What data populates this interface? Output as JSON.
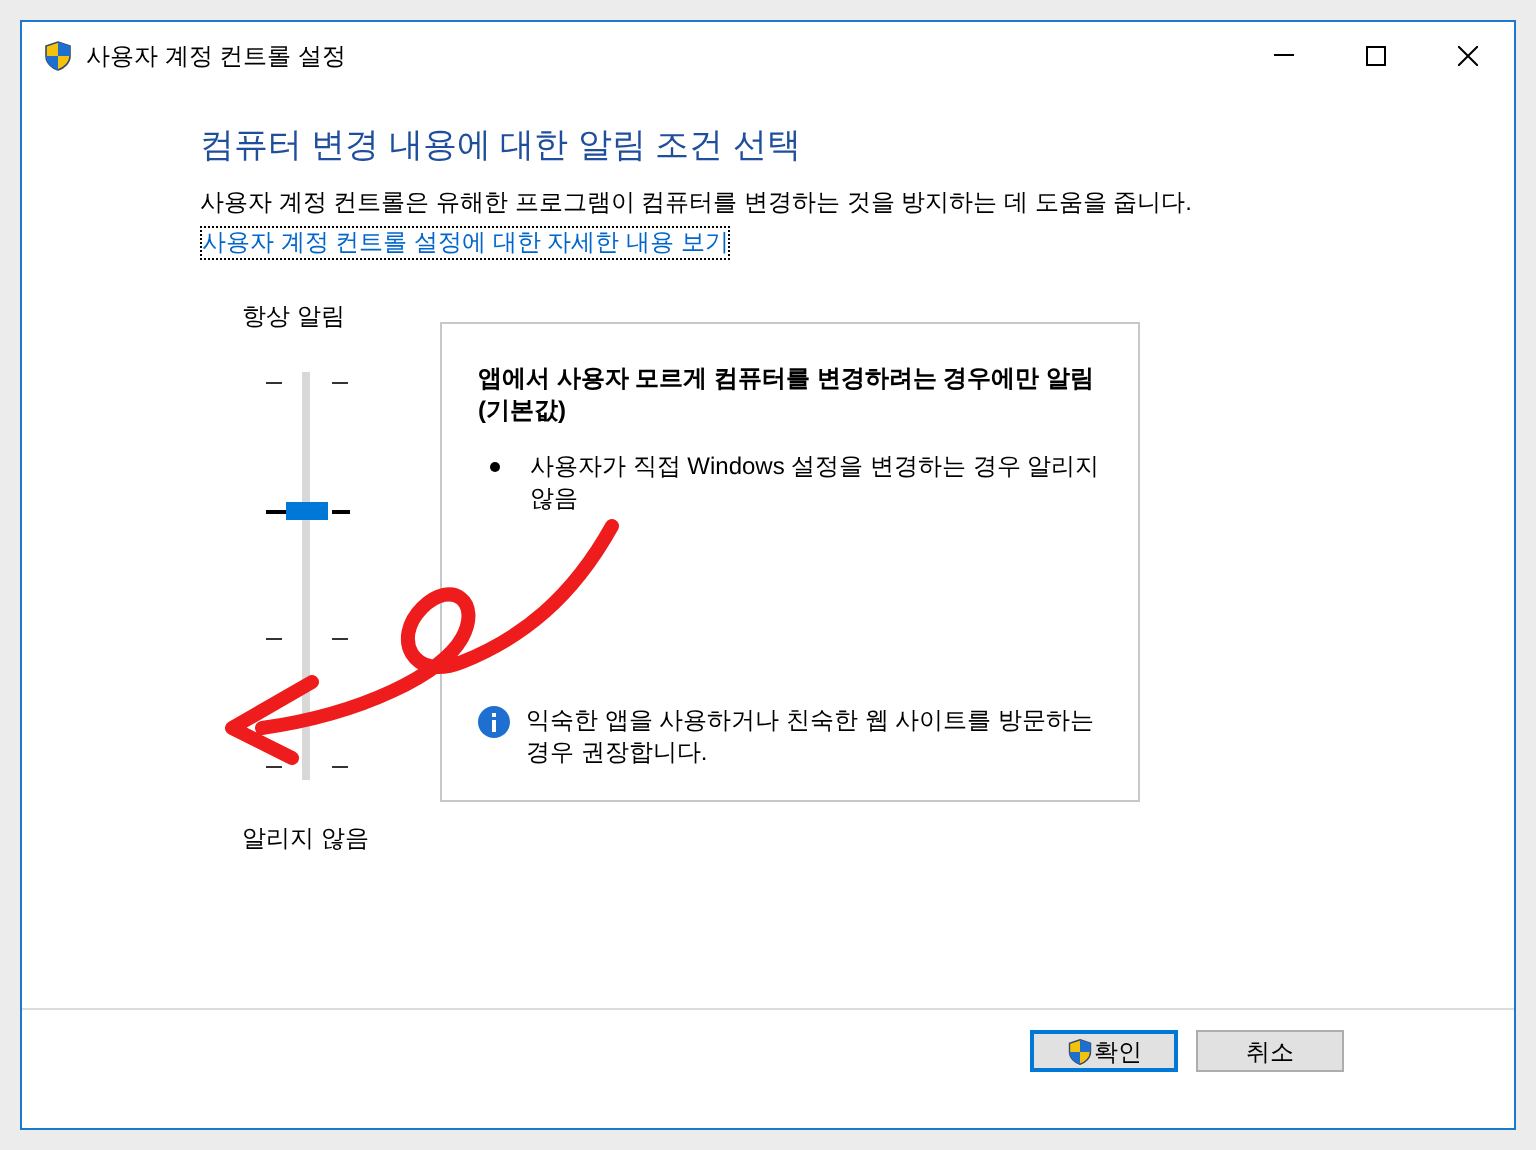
{
  "window": {
    "title": "사용자 계정 컨트롤 설정"
  },
  "heading": "컴퓨터 변경 내용에 대한 알림 조건 선택",
  "description": "사용자 계정 컨트롤은 유해한 프로그램이 컴퓨터를 변경하는 것을 방지하는 데 도움을 줍니다.",
  "link": "사용자 계정 컨트롤 설정에 대한 자세한 내용 보기",
  "slider": {
    "top_label": "항상 알림",
    "bottom_label": "알리지 않음",
    "level": 0.667
  },
  "info_panel": {
    "title": "앱에서 사용자 모르게 컴퓨터를 변경하려는 경우에만 알림 (기본값)",
    "bullets": [
      "사용자가 직접 Windows 설정을 변경하는 경우 알리지 않음"
    ],
    "note": "익숙한 앱을 사용하거나 친숙한 웹 사이트를 방문하는 경우 권장합니다."
  },
  "buttons": [
    {
      "label": "확인",
      "kind": "shield",
      "selected": true
    },
    {
      "label": "취소",
      "kind": "plain",
      "selected": false
    }
  ]
}
